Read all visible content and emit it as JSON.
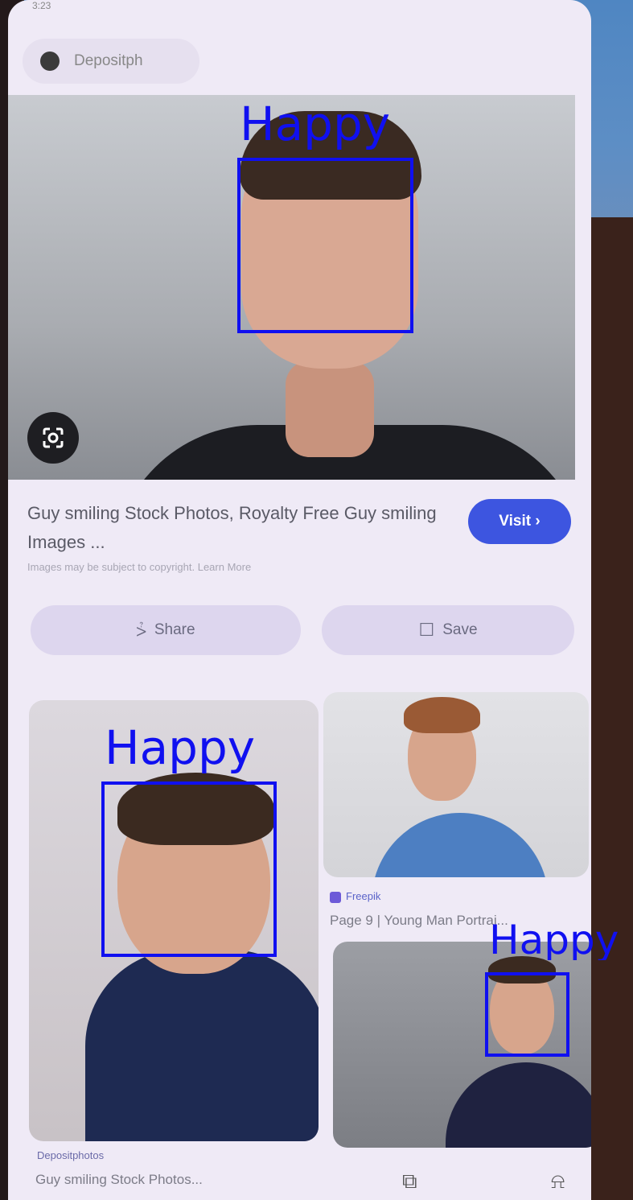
{
  "status_bar": {
    "time": "3:23"
  },
  "browser": {
    "url_text": "Depositph"
  },
  "hero": {
    "lens_icon": "lens-icon"
  },
  "result": {
    "title": "Guy smiling Stock Photos, Royalty Free Guy smiling Images ...",
    "visit_label": "Visit ›",
    "copyright_note": "Images may be subject to copyright. Learn More"
  },
  "actions": {
    "share_label": "Share",
    "save_label": "Save"
  },
  "related": [
    {
      "source": "Depositphotos",
      "title": "Guy smiling Stock Photos..."
    },
    {
      "source": "Freepik",
      "title": "Page 9 | Young Man Portrai..."
    }
  ],
  "detections": [
    {
      "label": "Happy"
    },
    {
      "label": "Happy"
    },
    {
      "label": "Happy"
    }
  ],
  "colors": {
    "accent": "#3d55e0",
    "detection_box": "#1010f0",
    "surface": "#efeaf6"
  }
}
